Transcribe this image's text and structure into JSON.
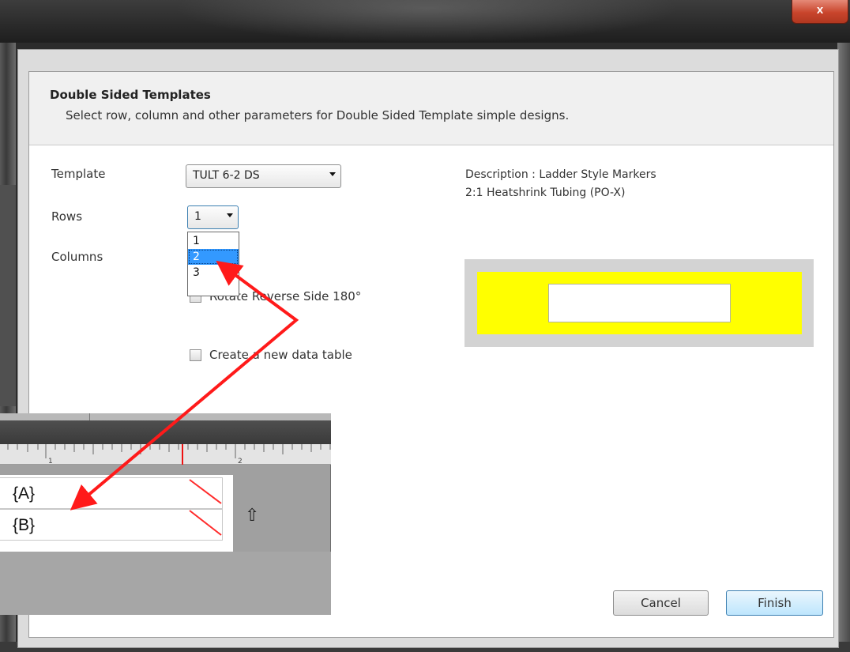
{
  "window": {
    "close_label": "x"
  },
  "dialog": {
    "title": "Double Sided Templates",
    "subtitle": "Select row, column and other parameters for Double Sided Template simple designs.",
    "template_label": "Template",
    "template_value": "TULT  6-2 DS",
    "rows_label": "Rows",
    "rows_value": "1",
    "rows_options": [
      "1",
      "2",
      "3"
    ],
    "rows_highlighted_option": "2",
    "columns_label": "Columns",
    "rotate_label": "Rotate Reverse Side 180°",
    "rotate_checked": false,
    "new_table_label": "Create a new data table",
    "new_table_checked": false,
    "description_line1": "Description :  Ladder Style Markers",
    "description_line2": "2:1 Heatshrink Tubing (PO-X)",
    "cancel_label": "Cancel",
    "finish_label": "Finish"
  },
  "label_preview": {
    "ruler_marks": [
      "1",
      "2"
    ],
    "rows": [
      "{A}",
      "{B}"
    ],
    "arrow_glyph": "⇧"
  },
  "annotation_color": "#ff1a1a",
  "preview_color": "#ffff00"
}
